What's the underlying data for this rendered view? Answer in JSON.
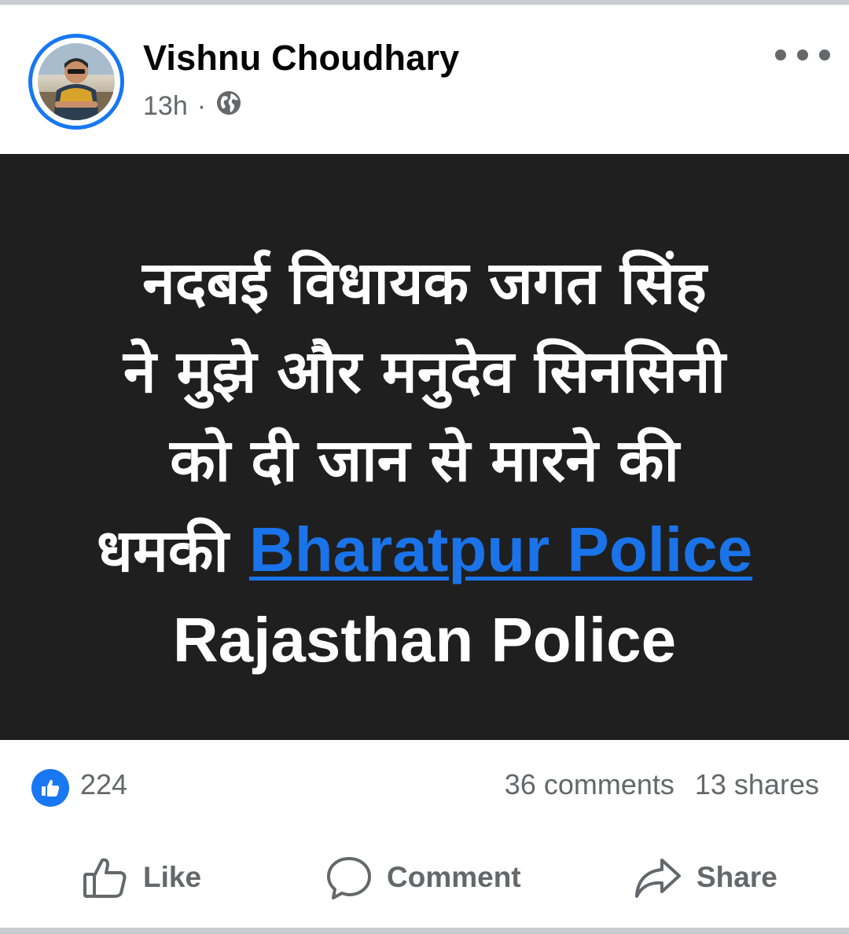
{
  "post": {
    "author": "Vishnu Choudhary",
    "time": "13h",
    "separator": "·",
    "audience_icon": "globe-icon",
    "image_text": {
      "line1": "नदबई विधायक जगत सिंह",
      "line2": "ने मुझे और मनुदेव सिनसिनी",
      "line3": "को दी जान से मारने की",
      "line4_prefix": "धमकी",
      "line4_link": "Bharatpur Police",
      "line5": "Rajasthan Police"
    },
    "colors": {
      "accent": "#1877f2",
      "link": "#1a73e8",
      "image_bg": "#1f1f1f",
      "muted": "#65676b"
    }
  },
  "reactions": {
    "likes": "224",
    "comments": "36 comments",
    "shares": "13 shares"
  },
  "actions": {
    "like": "Like",
    "comment": "Comment",
    "share": "Share"
  }
}
